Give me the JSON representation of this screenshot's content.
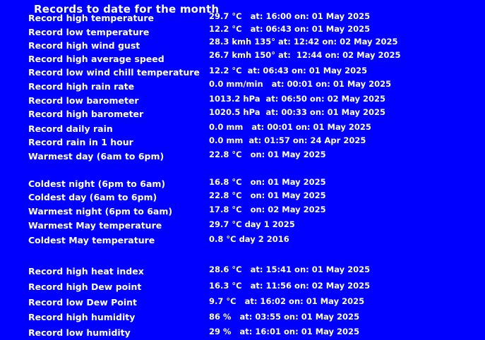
{
  "page": {
    "title": "Records to date for the month"
  },
  "records": [
    {
      "label": "Record high temperature",
      "value": "29.7 °C   at: 16:00 on: 01 May 2025"
    },
    {
      "label": "Record low temperature",
      "value": "12.2 °C   at: 06:43 on: 01 May 2025"
    },
    {
      "label": "Record high wind gust",
      "value": "28.3 kmh 135° at: 12:42 on: 02 May 2025"
    },
    {
      "label": "Record high average speed",
      "value": "26.7 kmh 150° at:  12:44 on: 02 May 2025"
    },
    {
      "label": "Record low wind chill temperature",
      "value": "12.2 °C  at: 06:43 on: 01 May 2025"
    },
    {
      "label": "Record high rain rate",
      "value": "0.0 mm/min   at: 00:01 on: 01 May 2025"
    },
    {
      "label": "Record low barometer",
      "value": "1013.2 hPa  at: 06:50 on: 02 May 2025"
    },
    {
      "label": "Record high barometer",
      "value": "1020.5 hPa  at: 00:33 on: 01 May 2025"
    },
    {
      "label": "Record daily rain",
      "value": "0.0 mm   at: 00:01 on: 01 May 2025"
    },
    {
      "label": "Record rain in 1 hour",
      "value": "0.0 mm  at: 01:57 on: 24 Apr 2025"
    },
    {
      "label": "Warmest day (6am to 6pm)",
      "value": "22.8 °C   on: 01 May 2025"
    },
    {
      "label": "Coldest night (6pm to 6am)",
      "value": "16.8 °C   on: 01 May 2025"
    },
    {
      "label": "Coldest day (6am to 6pm)",
      "value": "22.8 °C   on: 01 May 2025"
    },
    {
      "label": "Warmest night (6pm to 6am)",
      "value": "17.8 °C   on: 02 May 2025"
    },
    {
      "label": "Warmest May temperature",
      "value": "29.7 °C day 1 2025"
    },
    {
      "label": "Coldest May temperature",
      "value": "0.8 °C day 2 2016"
    },
    {
      "label": "Record high heat index",
      "value": "28.6 °C   at: 15:41 on: 01 May 2025"
    },
    {
      "label": "Record high Dew point",
      "value": "16.3 °C   at: 11:56 on: 02 May 2025"
    },
    {
      "label": "Record low Dew Point",
      "value": "9.7 °C   at: 16:02 on: 01 May 2025"
    },
    {
      "label": "Record high humidity",
      "value": "86 %   at: 03:55 on: 01 May 2025"
    },
    {
      "label": "Record low humidity",
      "value": "29 %   at: 16:01 on: 01 May 2025"
    }
  ]
}
